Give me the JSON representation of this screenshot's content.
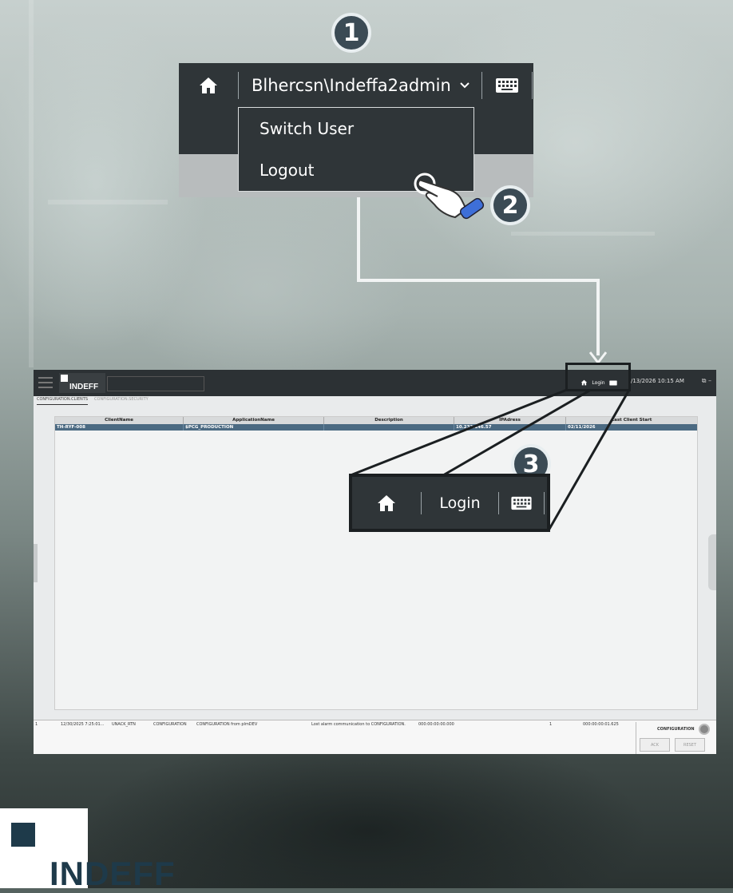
{
  "steps": {
    "one": "1",
    "two": "2",
    "three": "3"
  },
  "top_menu": {
    "user_label": "Blhercsn\\Indeffa2admin",
    "dropdown": [
      "Switch User",
      "Logout"
    ]
  },
  "app": {
    "logo_text": "INDEFF",
    "login_label": "Login",
    "datetime": "/13/2026 10:15 AM",
    "tabs": [
      "CONFIGURATION.CLIENTS",
      "CONFIGURATION.SECURITY"
    ],
    "grid": {
      "columns": [
        "ClientName",
        "ApplicationName",
        "Description",
        "IPAdress",
        "Last Client Start"
      ],
      "rows": [
        [
          "TH-RYF-008",
          "$PCG_PRODUCTION",
          "",
          "10.232.146.57",
          "02/11/2026"
        ]
      ]
    },
    "side_tab_label": "CONFIGURATION",
    "status_row": [
      "1",
      "12/30/2025 7:25:01...",
      "UNACK_RTN",
      "CONFIGURATION",
      "CONFIGURATION from plmDEV",
      "Lost alarm communication to CONFIGURATION.",
      "000:00:00:00.000",
      "1",
      "000:00:00:01.625"
    ],
    "alarm": {
      "label": "CONFIGURATION",
      "ack": "ACK",
      "reset": "RESET"
    }
  },
  "zoom_callout": {
    "login_label": "Login"
  },
  "brand": {
    "logo_text": "INDEFF"
  },
  "colors": {
    "bar": "#2f3538",
    "badge": "#3b4b55",
    "grid_row": "#4b6a82",
    "brand": "#1e3a4a"
  }
}
